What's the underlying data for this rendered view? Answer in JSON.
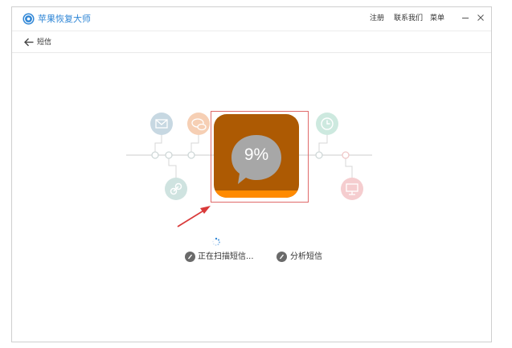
{
  "app": {
    "title": "苹果恢复大师"
  },
  "menu": {
    "register": "注册",
    "contact": "联系我们",
    "menu": "菜单"
  },
  "nav": {
    "current": "短信"
  },
  "progress": {
    "percent_label": "9%",
    "percent": 9
  },
  "steps": [
    {
      "label": "正在扫描短信...",
      "state": "active"
    },
    {
      "label": "分析短信",
      "state": "pending"
    }
  ],
  "colors": {
    "brand": "#2f86d6",
    "icon_bg": "#ad5a03",
    "icon_progress": "#ff8a00",
    "highlight": "#e06a6a",
    "arrow": "#d93a3a"
  },
  "icons": [
    "logo-icon",
    "back-arrow-icon",
    "mail-icon",
    "chat-bubble-icon",
    "link-icon",
    "message-bubble-icon",
    "clock-icon",
    "monitor-icon",
    "loading-spinner-icon",
    "step-icon"
  ]
}
